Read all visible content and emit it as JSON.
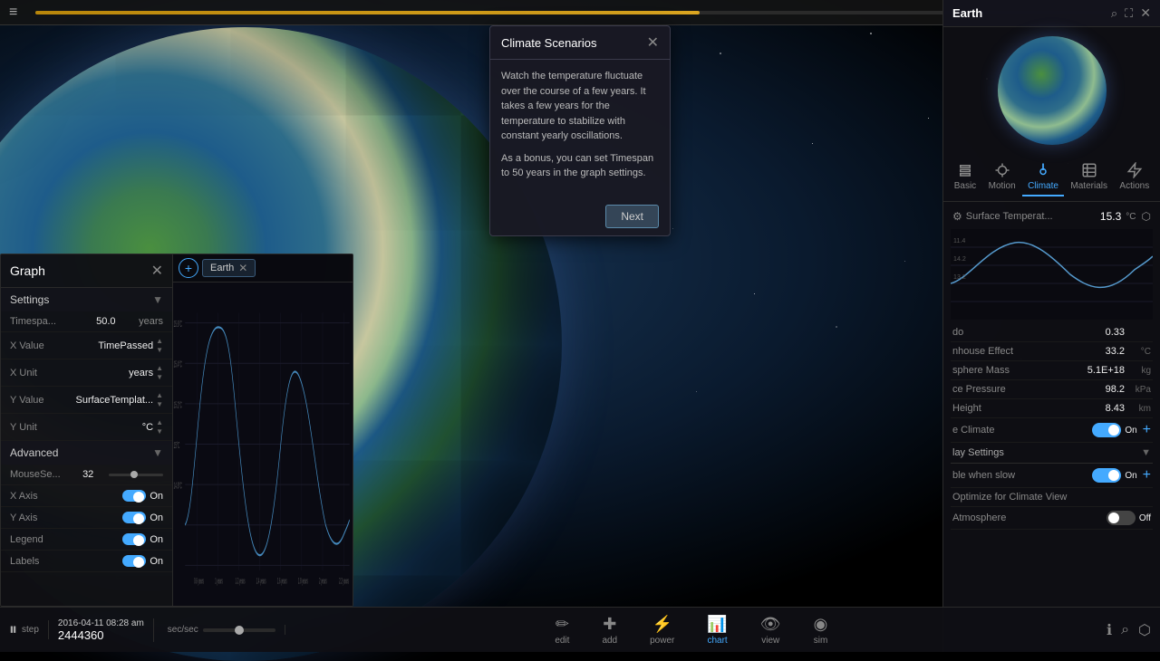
{
  "app": {
    "title": "Earth"
  },
  "topbar": {
    "menu_icon": "≡",
    "progress_percent": 60
  },
  "modal": {
    "title": "Climate Scenarios",
    "body_line1": "Watch the temperature fluctuate over the course of a few years. It takes a few years for the temperature to stabilize with constant yearly oscillations.",
    "body_line2": "As a bonus, you can set Timespan to 50 years in the graph settings.",
    "next_button": "Next",
    "close_icon": "✕"
  },
  "right_panel": {
    "title": "Earth",
    "close_icon": "✕",
    "search_icon": "⌕",
    "maximize_icon": "⛶",
    "tabs": [
      {
        "id": "basic",
        "label": "Basic",
        "icon": "bookmark"
      },
      {
        "id": "motion",
        "label": "Motion",
        "icon": "motion"
      },
      {
        "id": "climate",
        "label": "Climate",
        "icon": "thermometer",
        "active": true
      },
      {
        "id": "materials",
        "label": "Materials",
        "icon": "layers"
      },
      {
        "id": "actions",
        "label": "Actions",
        "icon": "actions"
      }
    ],
    "climate": {
      "surface_temp_label": "Surface Temperat...",
      "surface_temp_value": "15.3",
      "surface_temp_unit": "°C",
      "mini_chart_values": [
        11.4,
        14.2,
        13.2
      ],
      "albedo_label": "do",
      "albedo_value": "0.33",
      "greenhouse_label": "nhouse Effect",
      "greenhouse_value": "33.2",
      "greenhouse_unit": "°C",
      "atmosphere_mass_label": "sphere Mass",
      "atmosphere_mass_value": "5.1E+18",
      "atmosphere_mass_unit": "kg",
      "surface_pressure_label": "ce Pressure",
      "surface_pressure_value": "98.2",
      "surface_pressure_unit": "kPa",
      "scale_height_label": "Height",
      "scale_height_value": "8.43",
      "scale_height_unit": "km",
      "live_climate_label": "e Climate",
      "live_climate_on": "On",
      "live_climate_active": true,
      "display_settings_label": "lay Settings",
      "display_settings_expanded": true,
      "visible_slow_label": "ble when slow",
      "visible_slow_on": "On",
      "visible_slow_active": true,
      "optimize_label": "Optimize for Climate View",
      "v_atmosphere_label": "Atmosphere",
      "v_atmosphere_on": "Off",
      "v_atmosphere_active": false
    }
  },
  "graph": {
    "title": "Graph",
    "close_icon": "✕",
    "settings_section": "Settings",
    "advanced_section": "Advanced",
    "timespan_label": "Timespa...",
    "timespan_value": "50.0",
    "timespan_unit": "years",
    "x_value_label": "X Value",
    "x_value": "TimePassed",
    "x_unit_label": "X Unit",
    "x_unit": "years",
    "y_value_label": "Y Value",
    "y_value": "SurfaceTemplat...",
    "y_unit_label": "Y Unit",
    "y_unit": "°C",
    "mouse_sensitivity_label": "MouseSe...",
    "mouse_sensitivity_value": "32",
    "x_axis_label": "X Axis",
    "x_axis_on": "On",
    "x_axis_active": true,
    "y_axis_label": "Y Axis",
    "y_axis_on": "On",
    "y_axis_active": true,
    "legend_label": "Legend",
    "legend_on": "On",
    "legend_active": true,
    "labels_label": "Labels",
    "labels_on": "On",
    "chart_tabs": [
      "Earth"
    ],
    "y_axis_values": [
      "15.6°C",
      "15.4°C",
      "15.2°C",
      "15°C",
      "14.8°C"
    ],
    "x_axis_values": [
      "0.6 years",
      "1 years",
      "1.2 years",
      "1.4 years",
      "1.6 years",
      "1.8 years",
      "2 years",
      "2.2 years"
    ]
  },
  "bottom_bar": {
    "play_icon": "⏸",
    "date_time": "2016-04-11 08:28 am",
    "step_label": "step",
    "count_value": "2444360",
    "speed_value": "sec/sec",
    "tools": [
      {
        "id": "edit",
        "icon": "✏",
        "label": "edit"
      },
      {
        "id": "add",
        "icon": "✚",
        "label": "add"
      },
      {
        "id": "power",
        "icon": "⚡",
        "label": "power"
      },
      {
        "id": "chart",
        "icon": "📊",
        "label": "chart",
        "active": true
      },
      {
        "id": "view",
        "icon": "👁",
        "label": "view"
      },
      {
        "id": "sim",
        "icon": "◉",
        "label": "sim"
      }
    ],
    "right_icons": [
      {
        "id": "info",
        "icon": "ℹ"
      },
      {
        "id": "search",
        "icon": "⌕"
      },
      {
        "id": "share",
        "icon": "⬡"
      }
    ]
  }
}
